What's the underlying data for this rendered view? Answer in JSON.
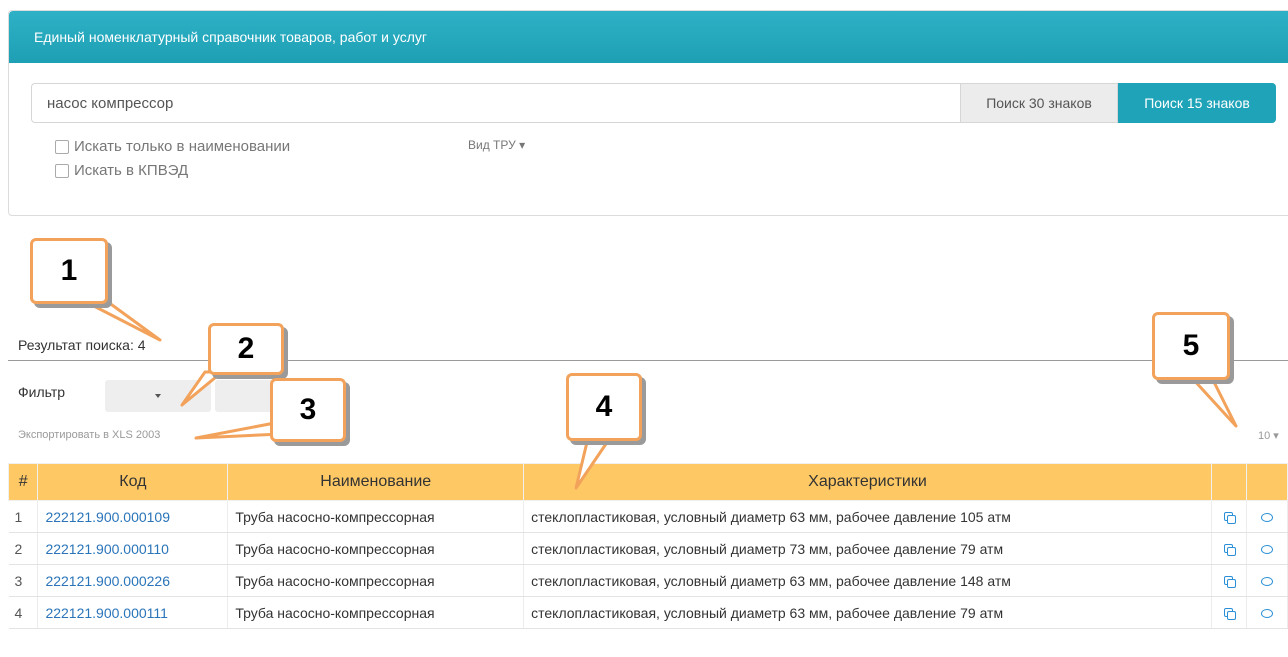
{
  "header": {
    "title": "Единый номенклатурный справочник товаров, работ и услуг"
  },
  "search": {
    "value": "насос компрессор",
    "btn30": "Поиск 30 знаков",
    "btn15": "Поиск 15 знаков",
    "check_name": "Искать только в наименовании",
    "check_kpved": "Искать в КПВЭД",
    "vid_tru": "Вид ТРУ ▾"
  },
  "results": {
    "summary": "Результат поиска: 4",
    "filter_label": "Фильтр",
    "export": "Экспортировать в XLS 2003",
    "page_size": "10 ▾"
  },
  "table": {
    "headers": [
      "#",
      "Код",
      "Наименование",
      "Характеристики"
    ],
    "rows": [
      {
        "num": "1",
        "code": "222121.900.000109",
        "name": "Труба насосно-компрессорная",
        "chars": "стеклопластиковая, условный диаметр 63 мм, рабочее давление 105 атм"
      },
      {
        "num": "2",
        "code": "222121.900.000110",
        "name": "Труба насосно-компрессорная",
        "chars": "стеклопластиковая, условный диаметр 73 мм, рабочее давление 79 атм"
      },
      {
        "num": "3",
        "code": "222121.900.000226",
        "name": "Труба насосно-компрессорная",
        "chars": "стеклопластиковая, условный диаметр 63 мм, рабочее давление 148 атм"
      },
      {
        "num": "4",
        "code": "222121.900.000111",
        "name": "Труба насосно-компрессорная",
        "chars": "стеклопластиковая, условный диаметр 63 мм, рабочее давление 79 атм"
      }
    ]
  },
  "callouts": [
    "1",
    "2",
    "3",
    "4",
    "5"
  ],
  "colors": {
    "header": "#1e9fb4",
    "table_header": "#fec965",
    "callout_border": "#f2a25a",
    "link": "#2a74b8"
  }
}
